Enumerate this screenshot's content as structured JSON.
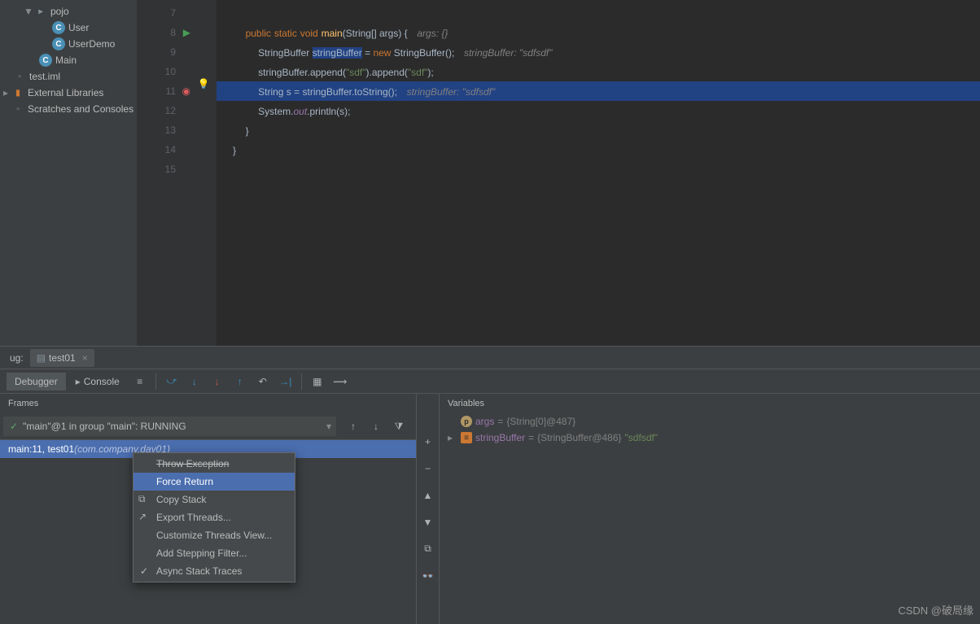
{
  "project_tree": {
    "pojo_folder": "pojo",
    "user_class": "User",
    "userdemo_class": "UserDemo",
    "main_class": "Main",
    "test_iml": "test.iml",
    "external_libs": "External Libraries",
    "scratches": "Scratches and Consoles"
  },
  "editor": {
    "lines": {
      "7": "7",
      "8": "8",
      "9": "9",
      "10": "10",
      "11": "11",
      "12": "12",
      "13": "13",
      "14": "14",
      "15": "15"
    },
    "code": {
      "line8_public": "public",
      "line8_static": "static",
      "line8_void": "void",
      "line8_main": "main",
      "line8_params": "(String[] args) {",
      "line8_comment": "args: {}",
      "line9_a": "StringBuffer ",
      "line9_var": "stringBuffer",
      "line9_eq": " = ",
      "line9_new": "new",
      "line9_b": " StringBuffer();",
      "line9_comment": "stringBuffer: \"sdfsdf\"",
      "line10": "stringBuffer.append(",
      "line10_s1": "\"sdf\"",
      "line10_b": ").append(",
      "line10_s2": "\"sdf\"",
      "line10_c": ");",
      "line11_a": "String s = stringBuffer.toString();",
      "line11_comment": "stringBuffer: \"sdfsdf\"",
      "line12_a": "System.",
      "line12_out": "out",
      "line12_b": ".println(s);",
      "line13": "}",
      "line14": "}"
    }
  },
  "debug": {
    "tab_label": "ug:",
    "file_tab": "test01",
    "debugger_tab": "Debugger",
    "console_tab": "Console",
    "frames_header": "Frames",
    "vars_header": "Variables",
    "thread_text": "\"main\"@1 in group \"main\": RUNNING",
    "frame_main": "main:11, test01 ",
    "frame_pkg": "(com.company.day01)"
  },
  "variables": {
    "args_name": "args",
    "args_eq": " = ",
    "args_val": "{String[0]@487}",
    "sb_name": "stringBuffer",
    "sb_eq": " = ",
    "sb_val": "{StringBuffer@486} ",
    "sb_str": "\"sdfsdf\""
  },
  "context_menu": {
    "throw": "Throw Exception",
    "force_return": "Force Return",
    "copy_stack": "Copy Stack",
    "export_threads": "Export Threads...",
    "customize": "Customize Threads View...",
    "add_filter": "Add Stepping Filter...",
    "async": "Async Stack Traces"
  },
  "watermark": "CSDN @破局缘"
}
